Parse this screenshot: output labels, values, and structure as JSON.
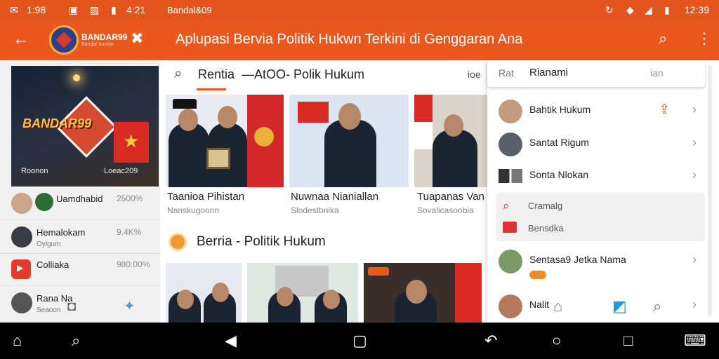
{
  "left_status": {
    "time": "1:98",
    "right": "4:21"
  },
  "left_appbar": {
    "brand": "BANDAR99",
    "brand_sub": "Bandar bandar"
  },
  "hero": {
    "text": "BANDAR99",
    "caption_left": "Roonon",
    "caption_right": "Loeac209"
  },
  "left_list": [
    {
      "title": "Uamdhabid",
      "subtitle": "",
      "value": "2500%"
    },
    {
      "title": "Hemalokam",
      "subtitle": "Oylgum",
      "value": "9.4K%"
    },
    {
      "title": "Colliaka",
      "subtitle": "",
      "value": "980.00%"
    },
    {
      "title": "Rana Na",
      "subtitle": "Seaoon",
      "value": ""
    }
  ],
  "main_status": {
    "carrier": "Bandal&09",
    "time": "12:39"
  },
  "main_appbar": {
    "title": "Aplupasi Bervia Politik Hukwn Terkini di Genggaran Ana"
  },
  "tabs": {
    "active": "Rentia",
    "second": "—AtOO- Polik Hukum",
    "third": "ioe"
  },
  "cards": [
    {
      "title": "Taanioa Pihistan",
      "subtitle": "Nanskugoonn"
    },
    {
      "title": "Nuwnaa Nianiallan",
      "subtitle": "Slodestbnika"
    },
    {
      "title": "Tuapanas Van",
      "subtitle": "Sovalicasoobia"
    }
  ],
  "section": {
    "title": "Berria - Politik Hukum"
  },
  "sheet": {
    "search": {
      "left": "Rat",
      "value": "Rianami",
      "right": "ian"
    },
    "rows": [
      {
        "label": "Bahtik Hukum"
      },
      {
        "label": "Santat Rigum"
      },
      {
        "label": "Sonta Nlokan"
      }
    ],
    "submenu": [
      {
        "label": "Cramalg"
      },
      {
        "label": "Bensdka"
      }
    ],
    "row4": {
      "label": "Sentasa9 Jetka Nama"
    },
    "row5": {
      "label": "Nalit"
    }
  },
  "accent_color": "#e8581f",
  "icons": [
    "home-icon",
    "search-icon",
    "back-icon",
    "circle-home-icon",
    "square-recents-icon"
  ]
}
